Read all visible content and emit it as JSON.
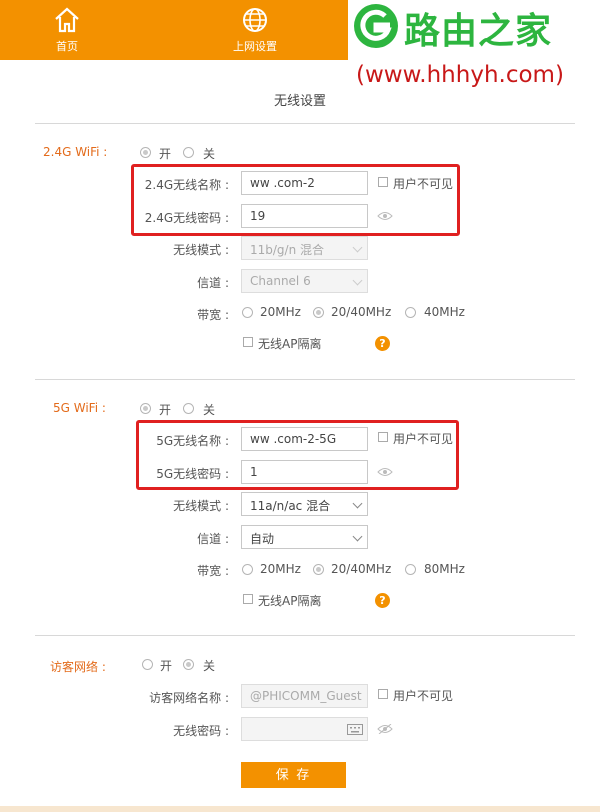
{
  "nav": {
    "home_label": "首页",
    "internet_label": "上网设置"
  },
  "watermark": {
    "title": "路由之家",
    "url": "(www.hhhyh.com)"
  },
  "page_title": "无线设置",
  "wifi24": {
    "section_label": "2.4G WiFi :",
    "on_label": "开",
    "off_label": "关",
    "enabled": true,
    "ssid_label": "2.4G无线名称 :",
    "ssid_value": "ww          .com-2",
    "hidden_label": "用户不可见",
    "password_label": "2.4G无线密码 :",
    "password_value": "19",
    "mode_label": "无线模式 :",
    "mode_value": "11b/g/n 混合",
    "channel_label": "信道 :",
    "channel_value": "Channel 6",
    "bandwidth_label": "带宽 :",
    "bandwidth_options": [
      "20MHz",
      "20/40MHz",
      "40MHz"
    ],
    "bandwidth_selected": "20/40MHz",
    "ap_isolation_label": "无线AP隔离",
    "help_icon": "?"
  },
  "wifi5": {
    "section_label": "5G WiFi :",
    "on_label": "开",
    "off_label": "关",
    "enabled": true,
    "ssid_label": "5G无线名称 :",
    "ssid_value": "ww         .com-2-5G",
    "hidden_label": "用户不可见",
    "password_label": "5G无线密码 :",
    "password_value": "1",
    "mode_label": "无线模式 :",
    "mode_value": "11a/n/ac 混合",
    "channel_label": "信道 :",
    "channel_value": "自动",
    "bandwidth_label": "带宽 :",
    "bandwidth_options": [
      "20MHz",
      "20/40MHz",
      "80MHz"
    ],
    "bandwidth_selected": "20/40MHz",
    "ap_isolation_label": "无线AP隔离",
    "help_icon": "?"
  },
  "guest": {
    "section_label": "访客网络 :",
    "on_label": "开",
    "off_label": "关",
    "enabled": false,
    "ssid_label": "访客网络名称 :",
    "ssid_placeholder": "@PHICOMM_Guest",
    "hidden_label": "用户不可见",
    "password_label": "无线密码 :"
  },
  "save_label": "保 存",
  "colors": {
    "brand_orange": "#f39100",
    "section_label": "#e36b1b",
    "highlight_red": "#e02020",
    "watermark_green": "#2db53f"
  }
}
